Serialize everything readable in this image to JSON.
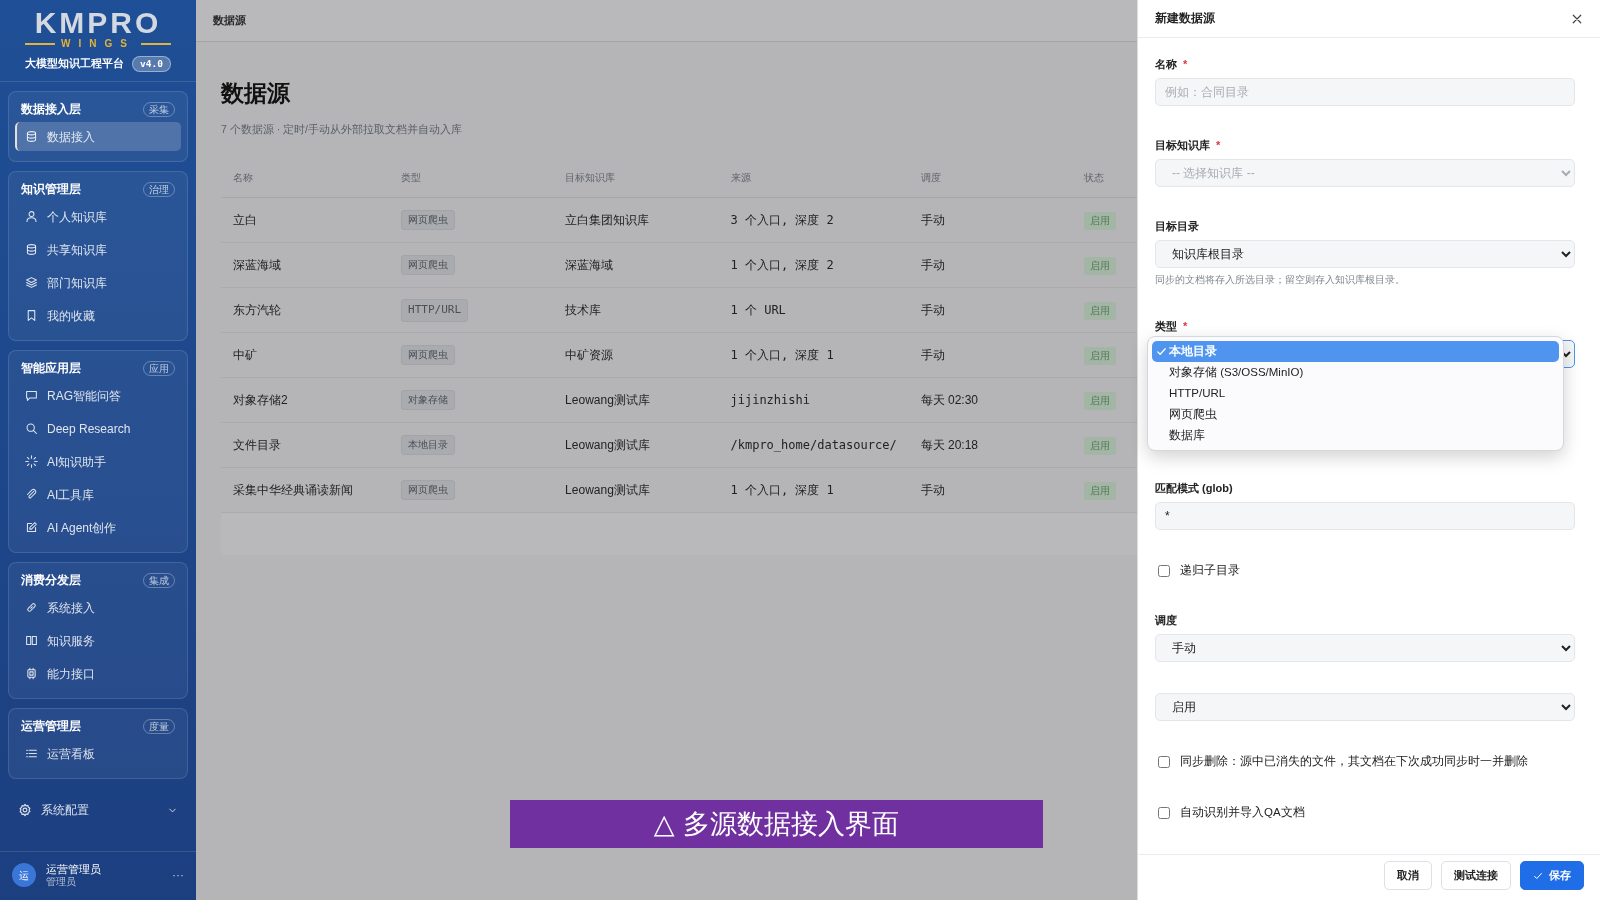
{
  "sidebar": {
    "logo": {
      "title": "KMPRO",
      "subtitle": "WINGS"
    },
    "platform": "大模型知识工程平台",
    "version": "v4.0",
    "groups": [
      {
        "title": "数据接入层",
        "badge": "采集",
        "items": [
          {
            "label": "数据接入",
            "selected": true
          }
        ]
      },
      {
        "title": "知识管理层",
        "badge": "治理",
        "items": [
          {
            "label": "个人知识库",
            "selected": false
          },
          {
            "label": "共享知识库",
            "selected": false
          },
          {
            "label": "部门知识库",
            "selected": false
          },
          {
            "label": "我的收藏",
            "selected": false
          }
        ]
      },
      {
        "title": "智能应用层",
        "badge": "应用",
        "items": [
          {
            "label": "RAG智能问答",
            "selected": false
          },
          {
            "label": "Deep Research",
            "selected": false
          },
          {
            "label": "AI知识助手",
            "selected": false
          },
          {
            "label": "AI工具库",
            "selected": false
          },
          {
            "label": "AI Agent创作",
            "selected": false
          }
        ]
      },
      {
        "title": "消费分发层",
        "badge": "集成",
        "items": [
          {
            "label": "系统接入",
            "selected": false
          },
          {
            "label": "知识服务",
            "selected": false
          },
          {
            "label": "能力接口",
            "selected": false
          }
        ]
      },
      {
        "title": "运营管理层",
        "badge": "度量",
        "items": [
          {
            "label": "运营看板",
            "selected": false
          }
        ]
      }
    ],
    "settings": {
      "label": "系统配置",
      "expanded": false
    },
    "user": {
      "avatar": "运",
      "name": "运营管理员",
      "role": "管理员",
      "menu": "···"
    }
  },
  "breadcrumb": "数据源",
  "page": {
    "title": "数据源",
    "summary": "7 个数据源 · 定时/手动从外部拉取文档并自动入库"
  },
  "table": {
    "columns": [
      "名称",
      "类型",
      "目标知识库",
      "来源",
      "调度",
      "状态"
    ],
    "rows": [
      {
        "name": "立白",
        "type": "网页爬虫",
        "target": "立白集团知识库",
        "source": "3 个入口, 深度 2",
        "schedule": "手动",
        "status": "启用"
      },
      {
        "name": "深蓝海域",
        "type": "网页爬虫",
        "target": "深蓝海域",
        "source": "1 个入口, 深度 2",
        "schedule": "手动",
        "status": "启用"
      },
      {
        "name": "东方汽轮",
        "type": "HTTP/URL",
        "target": "技术库",
        "source": "1 个 URL",
        "schedule": "手动",
        "status": "启用"
      },
      {
        "name": "中矿",
        "type": "网页爬虫",
        "target": "中矿资源",
        "source": "1 个入口, 深度 1",
        "schedule": "手动",
        "status": "启用"
      },
      {
        "name": "对象存储2",
        "type": "对象存储",
        "target": "Leowang测试库",
        "source": "jijinzhishi",
        "schedule": "每天 02:30",
        "status": "启用"
      },
      {
        "name": "文件目录",
        "type": "本地目录",
        "target": "Leowang测试库",
        "source": "/kmpro_home/datasource/",
        "schedule": "每天 20:18",
        "status": "启用"
      },
      {
        "name": "采集中华经典诵读新闻",
        "type": "网页爬虫",
        "target": "Leowang测试库",
        "source": "1 个入口, 深度 1",
        "schedule": "手动",
        "status": "启用"
      }
    ]
  },
  "drawer": {
    "title": "新建数据源",
    "fields": [
      {
        "kind": "input",
        "label": "名称",
        "required_mark": "*",
        "placeholder": "例如：合同目录"
      },
      {
        "kind": "select",
        "label": "目标知识库",
        "required_mark": "*",
        "placeholder": "-- 选择知识库 --"
      },
      {
        "kind": "select",
        "label": "目标目录",
        "value": "知识库根目录",
        "help": "同步的文档将存入所选目录；留空则存入知识库根目录。"
      },
      {
        "kind": "dropdown",
        "label": "类型",
        "required_mark": "*",
        "open": true,
        "options": [
          {
            "label": "本地目录",
            "selected": true
          },
          {
            "label": "对象存储 (S3/OSS/MinIO)",
            "selected": false
          },
          {
            "label": "HTTP/URL",
            "selected": false
          },
          {
            "label": "网页爬虫",
            "selected": false
          },
          {
            "label": "数据库",
            "selected": false
          }
        ]
      },
      {
        "kind": "input",
        "label": "匹配模式 (glob)",
        "value": "*"
      },
      {
        "kind": "checkbox",
        "label": "递归子目录",
        "checked": false
      },
      {
        "kind": "select",
        "label": "调度",
        "value": "手动"
      },
      {
        "kind": "select",
        "value": "启用"
      },
      {
        "kind": "checkbox",
        "label": "同步删除：源中已消失的文件，其文档在下次成功同步时一并删除",
        "checked": false
      },
      {
        "kind": "checkbox",
        "label": "自动识别并导入QA文档",
        "checked": false
      }
    ],
    "buttons": [
      {
        "label": "取消",
        "kind": "secondary"
      },
      {
        "label": "测试连接",
        "kind": "secondary"
      },
      {
        "label": "保存",
        "kind": "primary"
      }
    ]
  },
  "caption": "△ 多源数据接入界面"
}
